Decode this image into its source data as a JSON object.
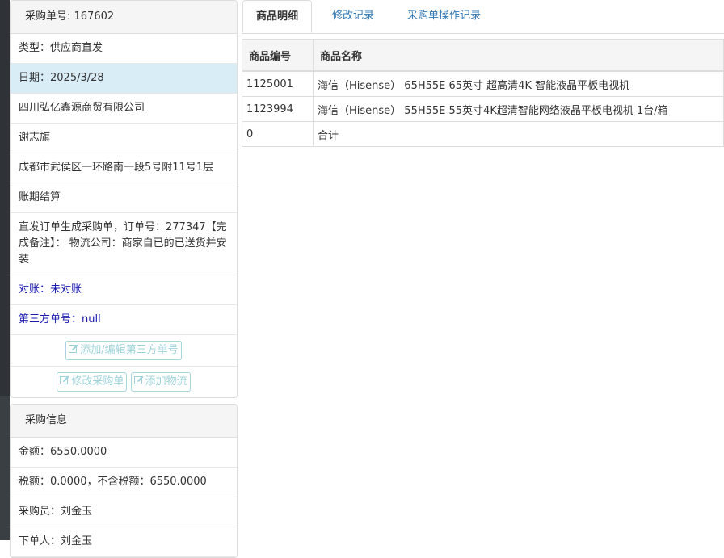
{
  "order_panel": {
    "heading": "采购单号: 167602",
    "type": "类型：供应商直发",
    "date": "日期：2025/3/28",
    "supplier": "四川弘亿鑫源商贸有限公司",
    "contact": "谢志旗",
    "address": "成都市武侯区一环路南一段5号附11号1层",
    "payment": "账期结算",
    "remark": "直发订单生成采购单，订单号：277347【完成备注】： 物流公司：商家自已的已送货并安装",
    "reconcile": "对账：未对账",
    "third_party_no": "第三方单号：null",
    "btn_add_third": "添加/编辑第三方单号",
    "btn_modify": "修改采购单",
    "btn_add_logistics": "添加物流"
  },
  "purchase_info": {
    "heading": "采购信息",
    "amount": "金额：6550.0000",
    "tax": "税额：0.0000，不含税额：6550.0000",
    "buyer": "采购员：刘金玉",
    "partial": "下单人：刘金玉"
  },
  "tabs": [
    "商品明细",
    "修改记录",
    "采购单操作记录"
  ],
  "table": {
    "headers": [
      "商品编号",
      "商品名称"
    ],
    "rows": [
      {
        "code": "1125001",
        "name": "海信（Hisense） 65H55E 65英寸 超高清4K 智能液晶平板电视机"
      },
      {
        "code": "1123994",
        "name": "海信（Hisense） 55H55E 55英寸4K超清智能网络液晶平板电视机 1台/箱"
      },
      {
        "code": "0",
        "name": "合计"
      }
    ]
  },
  "colors": {
    "accent": "#337ab7",
    "active_row": "#d9edf7",
    "link_text": "#1a1ab0",
    "disabled_btn": "#9fd3db"
  },
  "icons": {
    "edit": "edit-icon"
  }
}
